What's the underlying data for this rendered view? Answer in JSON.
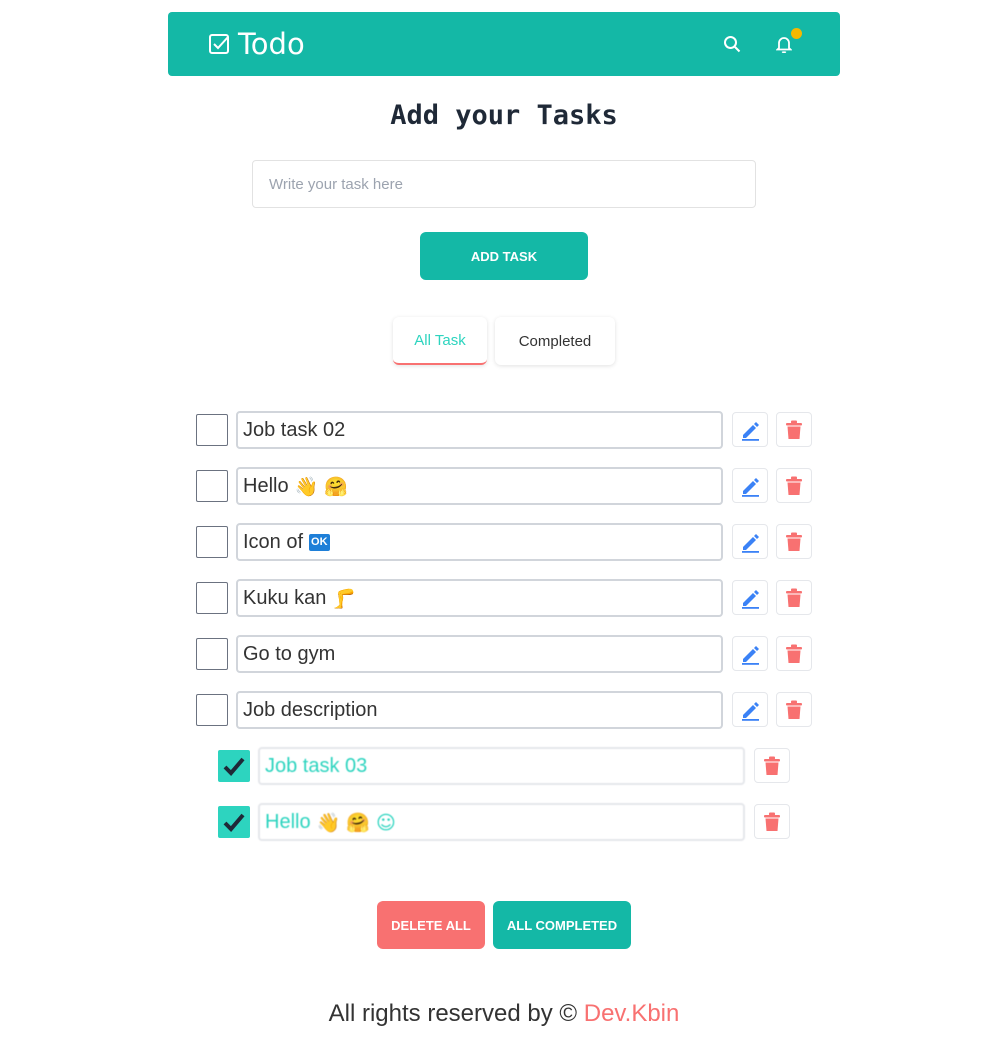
{
  "nav": {
    "title": "Todo",
    "notification_dot_color": "#f5b800"
  },
  "heading": "Add your Tasks",
  "input": {
    "placeholder": "Write your task here",
    "value": ""
  },
  "add_button": "Add Task",
  "tabs": [
    {
      "label": "All Task",
      "active": true
    },
    {
      "label": "Completed",
      "active": false
    }
  ],
  "tasks": [
    {
      "text": "Job task 02",
      "emoji": "",
      "completed": false
    },
    {
      "text": "Hello",
      "emoji": "👋 🤗",
      "completed": false
    },
    {
      "text": "Icon of",
      "emoji": "OK",
      "completed": false
    },
    {
      "text": "Kuku kan",
      "emoji": "🦵",
      "completed": false
    },
    {
      "text": "Go to gym",
      "emoji": "",
      "completed": false
    },
    {
      "text": "Job description",
      "emoji": "",
      "completed": false
    },
    {
      "text": "Job task 03",
      "emoji": "",
      "completed": true
    },
    {
      "text": "Hello",
      "emoji": "👋 🤗 ☺",
      "completed": true
    }
  ],
  "delete_all": "Delete All",
  "all_completed": "All Completed",
  "footer": {
    "text": "All rights reserved by ©",
    "author": "Dev.Kbin"
  },
  "colors": {
    "primary": "#14b8a6",
    "danger": "#f87171",
    "accent": "#2dd4bf",
    "edit": "#3b82f6"
  }
}
